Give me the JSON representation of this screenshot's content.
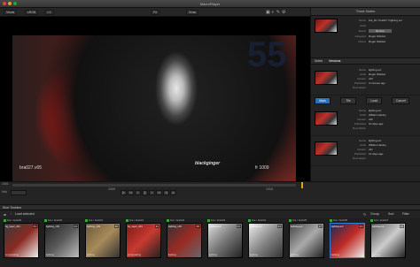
{
  "window": {
    "title": "MacroPlayer"
  },
  "toolbar": {
    "left_buttons": [
      "Views",
      "sRGB",
      "1:1"
    ],
    "center_label": "Fit",
    "middle_label": "Draw"
  },
  "viewer": {
    "car_number": "55",
    "clip_name": "bra027.v05",
    "watermark": "blackginger",
    "frame_label": "fr 1009",
    "top_left_badge": "Review"
  },
  "side_panel": {
    "header": "Track Notes",
    "path": "/bra_bk/vfx/bra027/lighting.exr",
    "fields": [
      {
        "k": "Name",
        "v": "bra_bk / bra027 / lighting.exr"
      },
      {
        "k": "Artist",
        "v": ""
      },
      {
        "k": "Status",
        "v": "Review"
      },
      {
        "k": "Assigned",
        "v": "Roger Weltied"
      },
      {
        "k": "Owner",
        "v": "Roger Weltied"
      }
    ],
    "tabs": [
      "Notes",
      "Versions"
    ],
    "versions": [
      {
        "fields": [
          {
            "k": "Name",
            "v": "lighting.exr"
          },
          {
            "k": "Artist",
            "v": "Roger Weltied"
          },
          {
            "k": "Version",
            "v": "v03"
          },
          {
            "k": "Published",
            "v": "3 minutes ago"
          },
          {
            "k": "Description",
            "v": ""
          }
        ]
      },
      {
        "fields": [
          {
            "k": "Name",
            "v": "lighting.exr"
          },
          {
            "k": "Artist",
            "v": "William Hanley"
          },
          {
            "k": "Version",
            "v": "v02"
          },
          {
            "k": "Published",
            "v": "10 days ago"
          },
          {
            "k": "Description",
            "v": ""
          }
        ]
      },
      {
        "fields": [
          {
            "k": "Name",
            "v": "lighting.exr"
          },
          {
            "k": "Artist",
            "v": "William Hanley"
          },
          {
            "k": "Version",
            "v": "v01"
          },
          {
            "k": "Published",
            "v": "14 days ago"
          },
          {
            "k": "Description",
            "v": ""
          }
        ]
      }
    ],
    "mode_buttons": [
      "Main",
      "Tile",
      "Load",
      "Cancel"
    ]
  },
  "transport": {
    "frame_start": "1001",
    "frame_end": "1016",
    "current_frame": "1009",
    "left_label": "Info",
    "controls": [
      "|<",
      "<<",
      "<",
      "||",
      ">",
      ">>",
      ">|",
      "o"
    ]
  },
  "browser": {
    "header": "Shot Timeline",
    "crumb": "Load selected",
    "right_buttons": [
      "Group",
      "Sort",
      "Filter"
    ],
    "clips": [
      {
        "path": "bra / bra020",
        "label": "bg_layer_v01",
        "tag": "compositing",
        "num": "31"
      },
      {
        "path": "bra / bra020",
        "label": "lighting_v01",
        "tag": "lighting",
        "num": "21"
      },
      {
        "path": "bra / bra021",
        "label": "lighting_v01",
        "tag": "lighting",
        "num": "30"
      },
      {
        "path": "bra / bra021",
        "label": "bg_layer_v01",
        "tag": "compositing",
        "num": "21"
      },
      {
        "path": "bra / bra022",
        "label": "lighting_v01",
        "tag": "lighting",
        "num": "20"
      },
      {
        "path": "bra / bra023",
        "label": "lighting.exr",
        "tag": "lighting",
        "num": "21"
      },
      {
        "path": "bra / bra024",
        "label": "lighting.exr",
        "tag": "lighting",
        "num": "21"
      },
      {
        "path": "bra / bra025",
        "label": "lighting.exr",
        "tag": "lighting",
        "num": "17"
      },
      {
        "path": "bra / bra026",
        "label": "lighting.exr",
        "tag": "lighting",
        "num": "21"
      },
      {
        "path": "bra / bra027",
        "label": "lighting.exr",
        "tag": "lighting",
        "num": "29"
      },
      {
        "path": "bra / bra028",
        "label": "lighting.exr",
        "tag": "lighting",
        "num": "34"
      }
    ]
  }
}
